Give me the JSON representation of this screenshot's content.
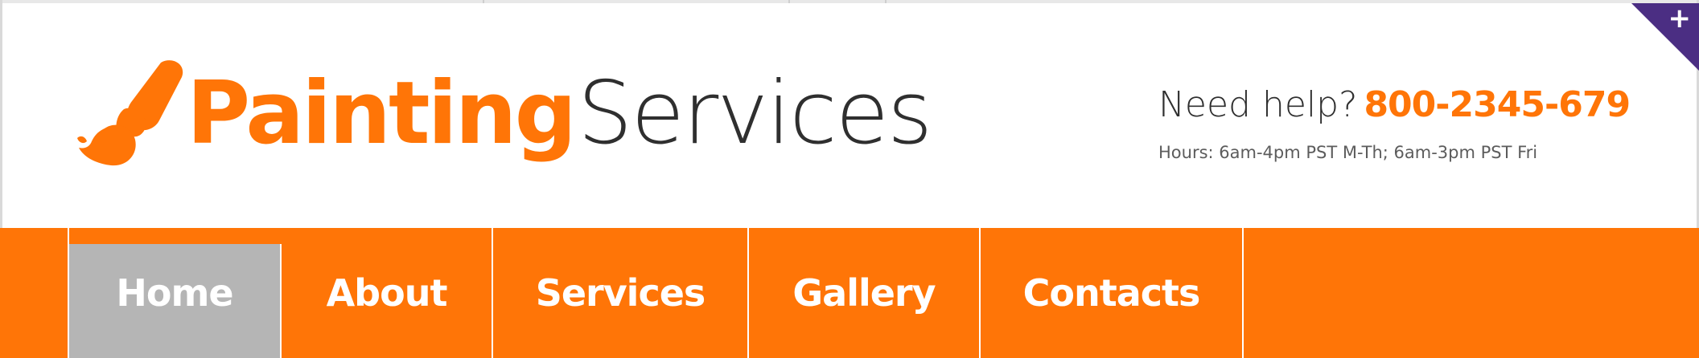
{
  "header": {
    "logo": {
      "strong_text": "Painting",
      "light_text": "Services",
      "icon": "paintbrush-icon"
    },
    "help": {
      "prefix": "Need help?",
      "phone": "800-2345-679",
      "hours": "Hours: 6am-4pm PST M-Th; 6am-3pm PST Fri"
    },
    "corner_badge": {
      "symbol": "+",
      "icon": "plus-icon"
    }
  },
  "nav": {
    "items": [
      {
        "label": "Home",
        "active": true
      },
      {
        "label": "About",
        "active": false
      },
      {
        "label": "Services",
        "active": false
      },
      {
        "label": "Gallery",
        "active": false
      },
      {
        "label": "Contacts",
        "active": false
      }
    ]
  },
  "colors": {
    "accent": "#ff7507",
    "active_tab": "#b5b5b5",
    "text_dark": "#2f2f2f",
    "badge": "#4b2e83"
  }
}
